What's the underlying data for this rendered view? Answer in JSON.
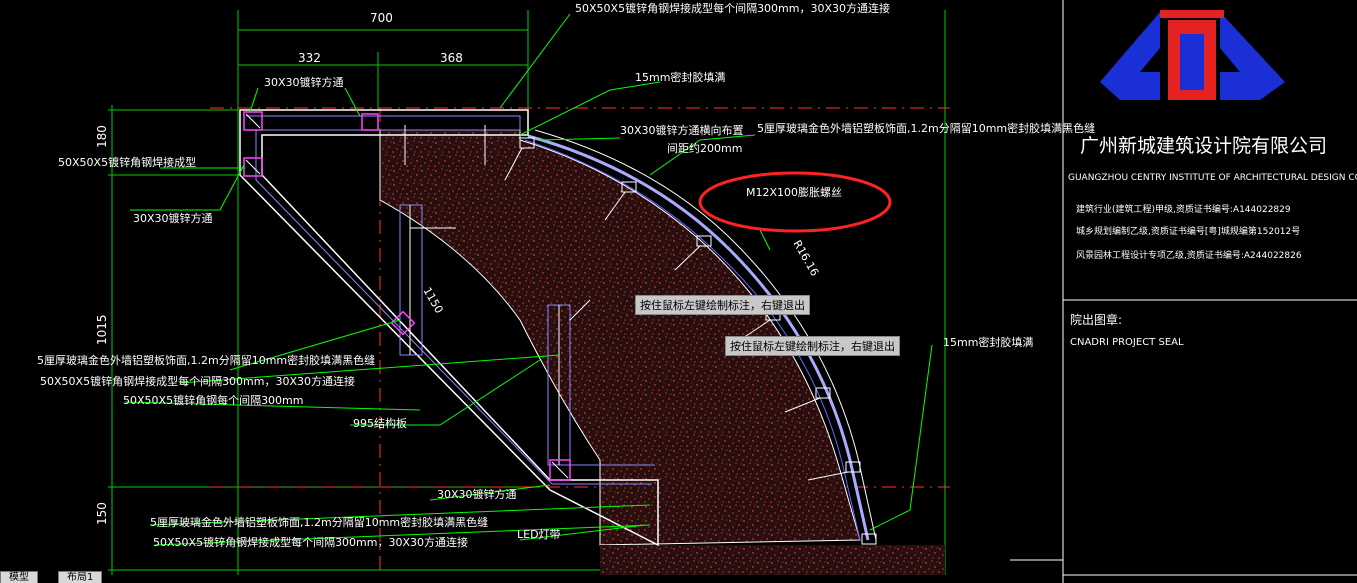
{
  "annotations": {
    "top_note": "50X50X5镀锌角钢焊接成型每个间隔300mm，30X30方通连接",
    "seal_15mm_top": "15mm密封胶填满",
    "tube_30_top": "30X30镀锌方通",
    "tube_30_direction": "30X30镀锌方通横向布置",
    "spacing_200": "间距约200mm",
    "aluminum_panel_top": "5厘厚玻璃金色外墙铝塑板饰面,1.2m分隔留10mm密封胶填满黑色缝",
    "angle_50_left": "50X50X5镀锌角钢焊接成型",
    "tube_30_left": "30X30镀锌方通",
    "bolt": "M12X100膨胀螺丝",
    "radius": "R16.16",
    "dim_1150": "1150",
    "panel_mid_1": "5厘厚玻璃金色外墙铝塑板饰面,1.2m分隔留10mm密封胶填满黑色缝",
    "panel_mid_2": "50X50X5镀锌角钢焊接成型每个间隔300mm，30X30方通连接",
    "panel_mid_3": "50X50X5镀锌角钢每个间隔300mm",
    "board_995": "995结构板",
    "tube_30_bottom": "30X30镀锌方通",
    "seal_15mm_right": "15mm密封胶填满",
    "panel_bottom_1": "5厘厚玻璃金色外墙铝塑板饰面,1.2m分隔留10mm密封胶填满黑色缝",
    "panel_bottom_2": "50X50X5镀锌角钢焊接成型每个间隔300mm，30X30方通连接",
    "led": "LED灯带"
  },
  "dimensions": {
    "top_total": "700",
    "top_left": "332",
    "top_right": "368",
    "side_180": "180",
    "side_1015": "1015",
    "side_150": "150"
  },
  "tooltips": {
    "tip1": "按住鼠标左键绘制标注，右键退出",
    "tip2": "按住鼠标左键绘制标注，右键退出"
  },
  "title_block": {
    "company_cn": "广州新城建筑设计院有限公司",
    "company_en": "GUANGZHOU CENTRY INSTITUTE OF ARCHITECTURAL DESIGN CO",
    "license_1": "建筑行业(建筑工程)甲级,资质证书编号:A144022829",
    "license_2": "城乡规划编制乙级,资质证书编号[粤]城规编第152012号",
    "license_3": "风景园林工程设计专项乙级,资质证书编号:A244022826",
    "seal_cn": "院出图章:",
    "seal_en": "CNADRI PROJECT SEAL"
  },
  "tabs": {
    "model": "模型",
    "layout1": "布局1"
  },
  "colors": {
    "background": "#000000",
    "leader": "#00ff00",
    "outline": "#ffffff",
    "frame": "#8888ff",
    "magenta": "#ff44ff",
    "red_dash": "#ff3333",
    "highlight_circle": "#ff2222",
    "logo_blue": "#1a2fd6",
    "logo_red": "#e52222"
  }
}
